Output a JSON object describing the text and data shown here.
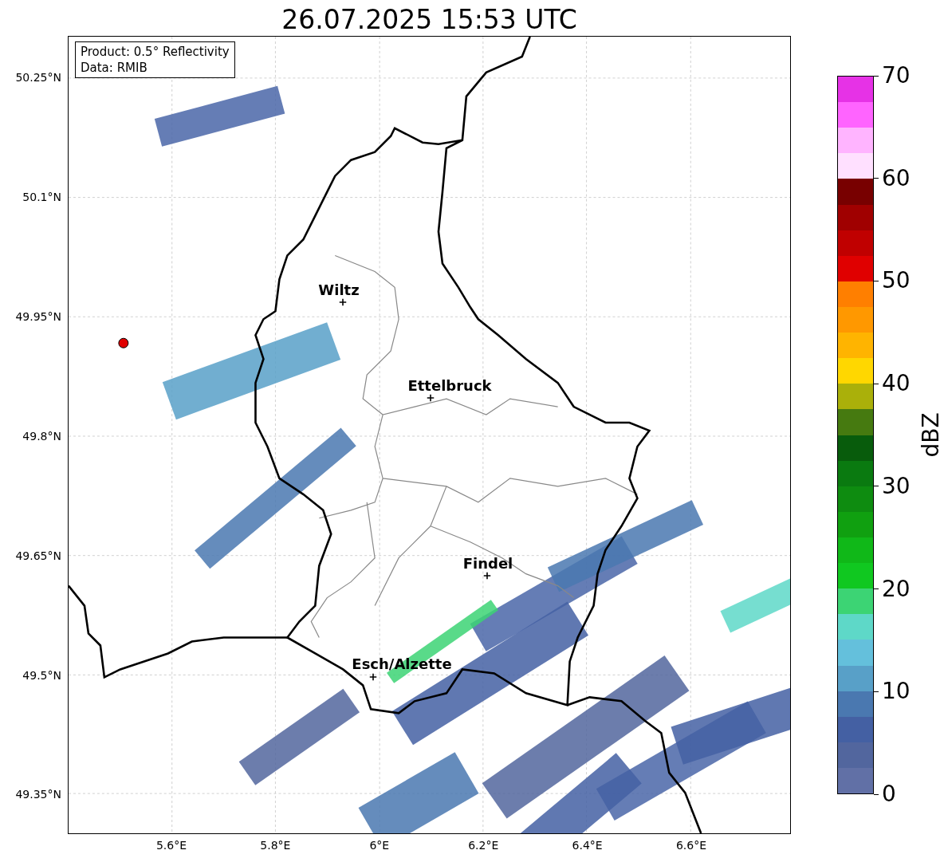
{
  "title": "26.07.2025 15:53 UTC",
  "info_box": {
    "lines": [
      "Product: 0.5° Reflectivity",
      "Data: RMIB"
    ]
  },
  "y_ticks": [
    "50.25°N",
    "50.1°N",
    "49.95°N",
    "49.8°N",
    "49.65°N",
    "49.5°N",
    "49.35°N"
  ],
  "x_ticks": [
    "5.6°E",
    "5.8°E",
    "6°E",
    "6.2°E",
    "6.4°E",
    "6.6°E"
  ],
  "cities": [
    {
      "name": "Wiltz"
    },
    {
      "name": "Ettelbruck"
    },
    {
      "name": "Findel"
    },
    {
      "name": "Esch/Alzette"
    }
  ],
  "colorbar": {
    "label": "dBZ",
    "ticks": [
      "70",
      "60",
      "50",
      "40",
      "30",
      "20",
      "10",
      "0"
    ],
    "segments": [
      {
        "color": "#e632e6"
      },
      {
        "color": "#ff64ff"
      },
      {
        "color": "#ffb4ff"
      },
      {
        "color": "#ffe0ff"
      },
      {
        "color": "#780000"
      },
      {
        "color": "#a00000"
      },
      {
        "color": "#c00000"
      },
      {
        "color": "#e00000"
      },
      {
        "color": "#ff7f00"
      },
      {
        "color": "#ff9800"
      },
      {
        "color": "#ffb400"
      },
      {
        "color": "#ffd700"
      },
      {
        "color": "#aab00a"
      },
      {
        "color": "#467a10"
      },
      {
        "color": "#085c0c"
      },
      {
        "color": "#0a7a10"
      },
      {
        "color": "#0e8c10"
      },
      {
        "color": "#10a010"
      },
      {
        "color": "#10b818"
      },
      {
        "color": "#10c820"
      },
      {
        "color": "#3cd474"
      },
      {
        "color": "#5ed8c8"
      },
      {
        "color": "#64c0dc"
      },
      {
        "color": "#58a0c8"
      },
      {
        "color": "#4a78b0"
      },
      {
        "color": "#4460a3"
      },
      {
        "color": "#52669e"
      },
      {
        "color": "#6170a6"
      }
    ]
  }
}
